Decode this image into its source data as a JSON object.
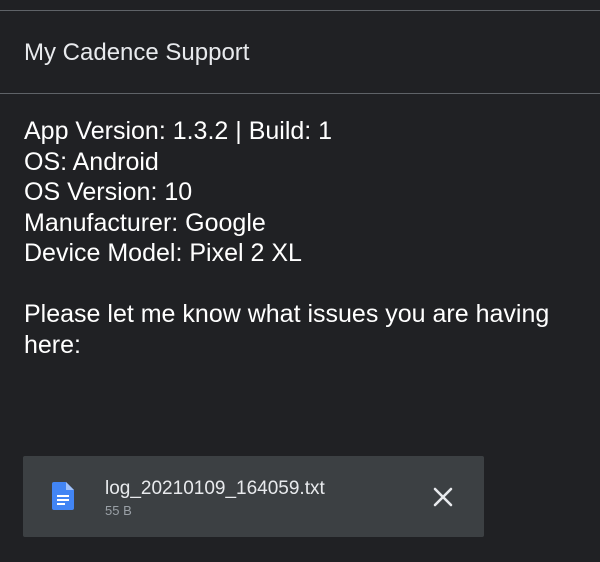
{
  "email": {
    "subject": "My Cadence Support",
    "body_lines": [
      "App Version: 1.3.2 | Build: 1",
      "OS: Android",
      "OS Version: 10",
      "Manufacturer: Google",
      "Device Model: Pixel 2 XL"
    ],
    "prompt": "Please let me know what issues you are having here:"
  },
  "attachment": {
    "file_name": "log_20210109_164059.txt",
    "file_size": "55 B",
    "icon": "document-icon",
    "remove_icon": "close-icon"
  },
  "colors": {
    "background": "#202124",
    "attachment_bg": "#3c4043",
    "doc_icon": "#4285f4",
    "divider": "#5f6368"
  }
}
